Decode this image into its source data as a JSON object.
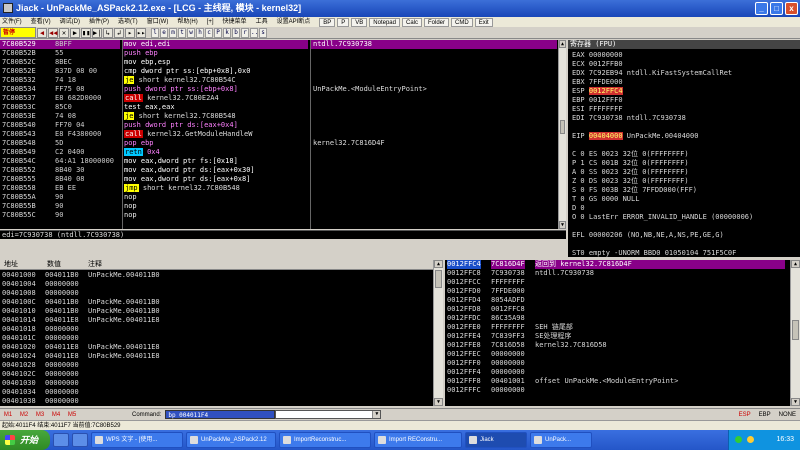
{
  "window": {
    "title": "Jiack - UnPackMe_ASPack2.12.exe - [LCG - 主线程, 模块 - kernel32]",
    "buttons": {
      "minimize": "_",
      "maximize": "□",
      "close": "x"
    }
  },
  "menu": {
    "items": [
      "文件(F)",
      "查看(V)",
      "调试(D)",
      "插件(P)",
      "选项(T)",
      "窗口(W)",
      "帮助(H)",
      "[+]",
      "快捷菜单",
      "工具",
      "设置API断点"
    ],
    "buttons": [
      "BP",
      "P",
      "VB",
      "Notepad",
      "Calc",
      "Folder",
      "CMD",
      "Exit"
    ]
  },
  "toolbar": {
    "pause_label": "暂停",
    "buttons": [
      "◀",
      "◀◀",
      "✕",
      "▶",
      "▮▮",
      "▶|",
      "↳",
      "↲",
      "▸",
      "▸▸"
    ],
    "letters": [
      "l",
      "e",
      "m",
      "t",
      "w",
      "h",
      "c",
      "P",
      "k",
      "b",
      "r",
      "...",
      "s"
    ]
  },
  "disasm": {
    "rows": [
      {
        "addr": "7C80B529",
        "hex": "8BFF",
        "asm": "mov edi,edi",
        "op": "mov",
        "cmt": "ntdll.7C930738",
        "sel": true
      },
      {
        "addr": "7C80B52B",
        "hex": "55",
        "asm": "push ebp",
        "op": "push",
        "cmt": ""
      },
      {
        "addr": "7C80B52C",
        "hex": "8BEC",
        "asm": "mov ebp,esp",
        "op": "mov",
        "cmt": ""
      },
      {
        "addr": "7C80B52E",
        "hex": "837D 08 00",
        "asm": "cmp dword ptr ss:[ebp+0x8],0x0",
        "op": "mov",
        "cmt": ""
      },
      {
        "addr": "7C80B532",
        "hex": "74 18",
        "asm": "short kernel32.7C80B54C",
        "op": "je",
        "cmt": ""
      },
      {
        "addr": "7C80B534",
        "hex": "FF75 08",
        "asm": "push dword ptr ss:[ebp+0x8]",
        "op": "push",
        "cmt": "UnPackMe.<ModuleEntryPoint>"
      },
      {
        "addr": "7C80B537",
        "hex": "E8 682D0000",
        "asm": "kernel32.7C80E2A4",
        "op": "call",
        "cmt": ""
      },
      {
        "addr": "7C80B53C",
        "hex": "85C0",
        "asm": "test eax,eax",
        "op": "test",
        "cmt": ""
      },
      {
        "addr": "7C80B53E",
        "hex": "74 08",
        "asm": "short kernel32.7C80B548",
        "op": "je",
        "cmt": ""
      },
      {
        "addr": "7C80B540",
        "hex": "FF70 04",
        "asm": "push dword ptr ds:[eax+0x4]",
        "op": "push",
        "cmt": ""
      },
      {
        "addr": "7C80B543",
        "hex": "E8 F4380000",
        "asm": "kernel32.GetModuleHandleW",
        "op": "call",
        "cmt": ""
      },
      {
        "addr": "7C80B548",
        "hex": "5D",
        "asm": "pop ebp",
        "op": "pop",
        "cmt": "kernel32.7C816D4F"
      },
      {
        "addr": "7C80B549",
        "hex": "C2 0400",
        "asm": "0x4",
        "op": "retn",
        "cmt": ""
      },
      {
        "addr": "7C80B54C",
        "hex": "64:A1 18000000",
        "asm": "mov eax,dword ptr fs:[0x18]",
        "op": "mov",
        "cmt": ""
      },
      {
        "addr": "7C80B552",
        "hex": "8B40 30",
        "asm": "mov eax,dword ptr ds:[eax+0x30]",
        "op": "mov",
        "cmt": ""
      },
      {
        "addr": "7C80B555",
        "hex": "8B40 08",
        "asm": "mov eax,dword ptr ds:[eax+0x8]",
        "op": "mov",
        "cmt": ""
      },
      {
        "addr": "7C80B558",
        "hex": "EB EE",
        "asm": "short kernel32.7C80B548",
        "op": "jmp",
        "cmt": ""
      },
      {
        "addr": "7C80B55A",
        "hex": "90",
        "asm": "nop",
        "op": "nop",
        "cmt": ""
      },
      {
        "addr": "7C80B55B",
        "hex": "90",
        "asm": "nop",
        "op": "nop",
        "cmt": ""
      },
      {
        "addr": "7C80B55C",
        "hex": "90",
        "asm": "nop",
        "op": "nop",
        "cmt": ""
      }
    ]
  },
  "info_line": "edi=7C930738 (ntdll.7C930738)",
  "registers": {
    "header": "寄存器 (FPU)",
    "lines": [
      {
        "text": "EAX 00000000"
      },
      {
        "text": "ECX 0012FFB0"
      },
      {
        "text": "EDX 7C92EB94 ntdll.KiFastSystemCallRet"
      },
      {
        "text": "EBX 7FFDE000"
      },
      {
        "text": "ESP ",
        "hl": "0012FFC4"
      },
      {
        "text": "EBP 0012FFF0"
      },
      {
        "text": "ESI FFFFFFFF"
      },
      {
        "text": "EDI 7C930738 ntdll.7C930738"
      },
      {
        "text": ""
      },
      {
        "text": "EIP ",
        "hl": "00404000",
        "rest": " UnPackMe.00404000"
      },
      {
        "text": ""
      },
      {
        "text": "C 0  ES 0023 32位 0(FFFFFFFF)"
      },
      {
        "text": "P 1  CS 001B 32位 0(FFFFFFFF)"
      },
      {
        "text": "A 0  SS 0023 32位 0(FFFFFFFF)"
      },
      {
        "text": "Z 0  DS 0023 32位 0(FFFFFFFF)"
      },
      {
        "text": "S 0  FS 003B 32位 7FFDD000(FFF)"
      },
      {
        "text": "T 0  GS 0000 NULL"
      },
      {
        "text": "D 0"
      },
      {
        "text": "O 0  LastErr ERROR_INVALID_HANDLE (00000006)"
      },
      {
        "text": ""
      },
      {
        "text": "EFL 00000206 (NO,NB,NE,A,NS,PE,GE,G)"
      },
      {
        "text": ""
      },
      {
        "text": "ST0 empty -UNORM BBD0 01050104 751F5C0F"
      },
      {
        "text": "ST1 empty +UNORM 006C 006F005C 005D0047"
      }
    ]
  },
  "dump": {
    "headers": {
      "addr": "地址",
      "hex": "数值",
      "comment": "注释"
    },
    "rows": [
      {
        "addr": "00401000",
        "val": "004011B0",
        "cmt": "UnPackMe.004011B0"
      },
      {
        "addr": "00401004",
        "val": "00000000",
        "cmt": ""
      },
      {
        "addr": "00401008",
        "val": "00000000",
        "cmt": ""
      },
      {
        "addr": "0040100C",
        "val": "004011B0",
        "cmt": "UnPackMe.004011B0"
      },
      {
        "addr": "00401010",
        "val": "004011B0",
        "cmt": "UnPackMe.004011B0"
      },
      {
        "addr": "00401014",
        "val": "004011E8",
        "cmt": "UnPackMe.004011E8"
      },
      {
        "addr": "00401018",
        "val": "00000000",
        "cmt": ""
      },
      {
        "addr": "0040101C",
        "val": "00000000",
        "cmt": ""
      },
      {
        "addr": "00401020",
        "val": "004011E8",
        "cmt": "UnPackMe.004011E8"
      },
      {
        "addr": "00401024",
        "val": "004011E8",
        "cmt": "UnPackMe.004011E8"
      },
      {
        "addr": "00401028",
        "val": "00000000",
        "cmt": ""
      },
      {
        "addr": "0040102C",
        "val": "00000000",
        "cmt": ""
      },
      {
        "addr": "00401030",
        "val": "00000000",
        "cmt": ""
      },
      {
        "addr": "00401034",
        "val": "00000000",
        "cmt": ""
      },
      {
        "addr": "00401038",
        "val": "00000000",
        "cmt": ""
      }
    ]
  },
  "stack": {
    "rows": [
      {
        "addr": "0012FFC4",
        "val": "7C816D4F",
        "cmt": "返回到 kernel32.7C816D4F",
        "sel": true
      },
      {
        "addr": "0012FFC8",
        "val": "7C930738",
        "cmt": "ntdll.7C930738"
      },
      {
        "addr": "0012FFCC",
        "val": "FFFFFFFF",
        "cmt": ""
      },
      {
        "addr": "0012FFD0",
        "val": "7FFDE000",
        "cmt": ""
      },
      {
        "addr": "0012FFD4",
        "val": "8054ADFD",
        "cmt": ""
      },
      {
        "addr": "0012FFD8",
        "val": "0012FFC8",
        "cmt": ""
      },
      {
        "addr": "0012FFDC",
        "val": "86C35A98",
        "cmt": ""
      },
      {
        "addr": "0012FFE0",
        "val": "FFFFFFFF",
        "cmt": "SEH 链尾部"
      },
      {
        "addr": "0012FFE4",
        "val": "7C839FF3",
        "cmt": "SE处理程序"
      },
      {
        "addr": "0012FFE8",
        "val": "7C816D58",
        "cmt": "kernel32.7C816D58"
      },
      {
        "addr": "0012FFEC",
        "val": "00000000",
        "cmt": ""
      },
      {
        "addr": "0012FFF0",
        "val": "00000000",
        "cmt": ""
      },
      {
        "addr": "0012FFF4",
        "val": "00000000",
        "cmt": ""
      },
      {
        "addr": "0012FFF8",
        "val": "00401001",
        "cmt": "offset UnPackMe.<ModuleEntryPoint>"
      },
      {
        "addr": "0012FFFC",
        "val": "00000000",
        "cmt": ""
      }
    ]
  },
  "cmdbar": {
    "tabs": [
      "M1",
      "M2",
      "M3",
      "M4",
      "M5"
    ],
    "label": "Command:",
    "input_value": "bp 004011F4",
    "right_tabs": [
      "ESP",
      "EBP",
      "NONE"
    ]
  },
  "status": "起始:4011F4 结束:4011F7 当前值:7C80B529",
  "taskbar": {
    "start": "开始",
    "tasks": [
      "WPS 文字 - [使用...",
      "UnPackMe_ASPack2.12",
      "ImportReconstruc...",
      "Import REConstru...",
      "Jiack",
      "UnPack..."
    ],
    "clock": "16:33"
  }
}
